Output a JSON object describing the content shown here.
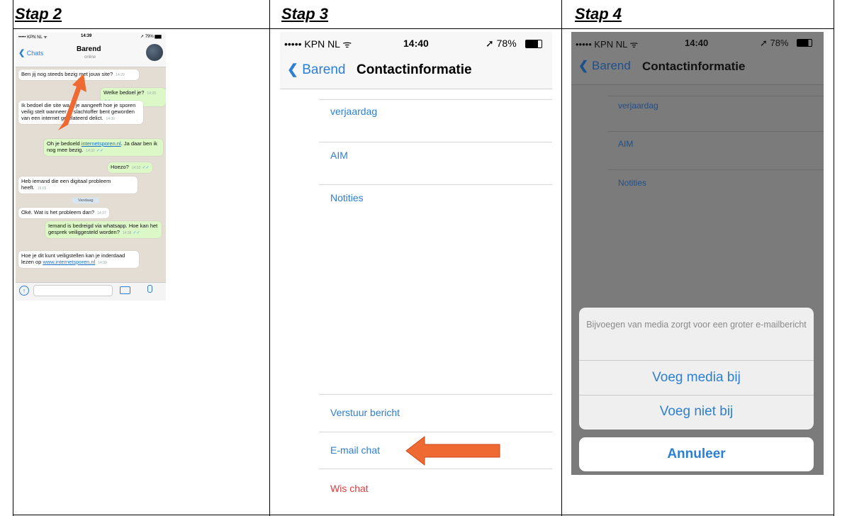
{
  "steps": {
    "s2": "Stap 2",
    "s3": "Stap 3",
    "s4": "Stap 4"
  },
  "phone1": {
    "status": {
      "carrier": "••••• KPN NL ᯤ",
      "time": "14:39",
      "battery": "➚ 79% ▆▆"
    },
    "back": "Chats",
    "contact_name": "Barend",
    "contact_status": "online",
    "messages": [
      {
        "from": "them",
        "text": "Ben jij nog steeds bezig met jouw site?",
        "time": "14:29"
      },
      {
        "from": "me",
        "text": "Welke bedoel je?",
        "time": "14:29"
      },
      {
        "from": "them",
        "text": "Ik bedoel die site waar je aangeeft hoe je sporen veilig stelt wanneer je slachtoffer bent geworden van een internet gerelateerd delict.",
        "time": "14:30"
      },
      {
        "from": "me",
        "text_pre": "Oh je bedoeld ",
        "link": "internetsporen.nl",
        "text_post": ". Ja daar ben ik nog mee bezig.",
        "time": "14:32"
      },
      {
        "from": "me",
        "text": "Hoezo?",
        "time": "14:32"
      },
      {
        "from": "them",
        "text": "Heb iemand die een digitaal probleem heeft.",
        "time": "15:03"
      },
      {
        "from": "them",
        "text": "Oké. Wat is het probleem dan?",
        "time": "14:37"
      },
      {
        "from": "me",
        "text": "Iemand is bedreigd via whatsapp. Hoe kan het gesprek veiliggesteld worden?",
        "time": "14:38"
      },
      {
        "from": "them",
        "text_pre": "Hoe je dit kunt veiligstellen kan je inderdaad lezen op ",
        "link": "www.internetsporen.nl",
        "time": "14:39"
      }
    ],
    "day_label": "Vandaag"
  },
  "phone2": {
    "status": {
      "carrier": "••••• KPN NL ᯤ",
      "time": "14:40",
      "battery": "➚ 78%"
    },
    "back": "Barend",
    "title": "Contactinformatie",
    "fields": [
      "verjaardag",
      "AIM",
      "Notities"
    ],
    "actions": [
      "Verstuur bericht",
      "E-mail chat",
      "Wis chat"
    ]
  },
  "phone3": {
    "status": {
      "carrier": "••••• KPN NL ᯤ",
      "time": "14:40",
      "battery": "➚ 78%"
    },
    "back": "Barend",
    "title": "Contactinformatie",
    "fields": [
      "verjaardag",
      "AIM",
      "Notities"
    ],
    "sheet_message": "Bijvoegen van media zorgt voor een groter e-mailbericht",
    "sheet_option1": "Voeg media bij",
    "sheet_option2": "Voeg niet bij",
    "cancel": "Annuleer"
  },
  "colors": {
    "ios_blue": "#2d7fd2",
    "destructive": "#e03b3b",
    "arrow": "#ef6a33",
    "chat_green": "#dcf8c6"
  }
}
